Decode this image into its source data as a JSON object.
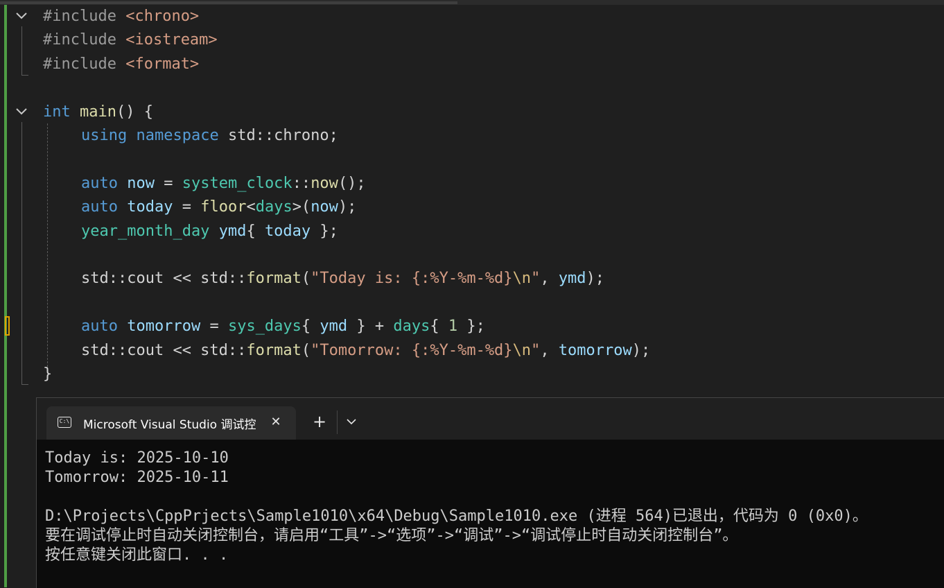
{
  "editor": {
    "lines": [
      {
        "tokens": [
          {
            "c": "pp",
            "t": "#include "
          },
          {
            "c": "inc",
            "t": "<chrono>"
          }
        ]
      },
      {
        "tokens": [
          {
            "c": "pp",
            "t": "#include "
          },
          {
            "c": "inc",
            "t": "<iostream>"
          }
        ]
      },
      {
        "tokens": [
          {
            "c": "pp",
            "t": "#include "
          },
          {
            "c": "inc",
            "t": "<format>"
          }
        ]
      },
      {
        "tokens": []
      },
      {
        "tokens": [
          {
            "c": "kw",
            "t": "int"
          },
          {
            "c": "pl",
            "t": " "
          },
          {
            "c": "fn",
            "t": "main"
          },
          {
            "c": "pl",
            "t": "() {"
          }
        ]
      },
      {
        "indent": true,
        "tokens": [
          {
            "c": "kw",
            "t": "using"
          },
          {
            "c": "pl",
            "t": " "
          },
          {
            "c": "kw",
            "t": "namespace"
          },
          {
            "c": "pl",
            "t": " std::chrono;"
          }
        ]
      },
      {
        "tokens": []
      },
      {
        "indent": true,
        "tokens": [
          {
            "c": "kw",
            "t": "auto"
          },
          {
            "c": "pl",
            "t": " "
          },
          {
            "c": "var",
            "t": "now"
          },
          {
            "c": "pl",
            "t": " = "
          },
          {
            "c": "ty",
            "t": "system_clock"
          },
          {
            "c": "pl",
            "t": "::"
          },
          {
            "c": "fn",
            "t": "now"
          },
          {
            "c": "pl",
            "t": "();"
          }
        ]
      },
      {
        "indent": true,
        "tokens": [
          {
            "c": "kw",
            "t": "auto"
          },
          {
            "c": "pl",
            "t": " "
          },
          {
            "c": "var",
            "t": "today"
          },
          {
            "c": "pl",
            "t": " = "
          },
          {
            "c": "fn",
            "t": "floor"
          },
          {
            "c": "pl",
            "t": "<"
          },
          {
            "c": "ty",
            "t": "days"
          },
          {
            "c": "pl",
            "t": ">("
          },
          {
            "c": "var",
            "t": "now"
          },
          {
            "c": "pl",
            "t": ");"
          }
        ]
      },
      {
        "indent": true,
        "tokens": [
          {
            "c": "ty",
            "t": "year_month_day"
          },
          {
            "c": "pl",
            "t": " "
          },
          {
            "c": "var",
            "t": "ymd"
          },
          {
            "c": "pl",
            "t": "{ "
          },
          {
            "c": "var",
            "t": "today"
          },
          {
            "c": "pl",
            "t": " };"
          }
        ]
      },
      {
        "tokens": []
      },
      {
        "indent": true,
        "tokens": [
          {
            "c": "pl",
            "t": "std::cout << std::"
          },
          {
            "c": "fn",
            "t": "format"
          },
          {
            "c": "pl",
            "t": "("
          },
          {
            "c": "str",
            "t": "\"Today is: {:%Y-%m-%d}"
          },
          {
            "c": "esc",
            "t": "\\n"
          },
          {
            "c": "str",
            "t": "\""
          },
          {
            "c": "pl",
            "t": ", "
          },
          {
            "c": "var",
            "t": "ymd"
          },
          {
            "c": "pl",
            "t": ");"
          }
        ]
      },
      {
        "tokens": []
      },
      {
        "indent": true,
        "tokens": [
          {
            "c": "kw",
            "t": "auto"
          },
          {
            "c": "pl",
            "t": " "
          },
          {
            "c": "var",
            "t": "tomorrow"
          },
          {
            "c": "pl",
            "t": " = "
          },
          {
            "c": "ty",
            "t": "sys_days"
          },
          {
            "c": "pl",
            "t": "{ "
          },
          {
            "c": "var",
            "t": "ymd"
          },
          {
            "c": "pl",
            "t": " } + "
          },
          {
            "c": "ty",
            "t": "days"
          },
          {
            "c": "pl",
            "t": "{ "
          },
          {
            "c": "num",
            "t": "1"
          },
          {
            "c": "pl",
            "t": " };"
          }
        ]
      },
      {
        "indent": true,
        "tokens": [
          {
            "c": "pl",
            "t": "std::cout << std::"
          },
          {
            "c": "fn",
            "t": "format"
          },
          {
            "c": "pl",
            "t": "("
          },
          {
            "c": "str",
            "t": "\"Tomorrow: {:%Y-%m-%d}"
          },
          {
            "c": "esc",
            "t": "\\n"
          },
          {
            "c": "str",
            "t": "\""
          },
          {
            "c": "pl",
            "t": ", "
          },
          {
            "c": "var",
            "t": "tomorrow"
          },
          {
            "c": "pl",
            "t": ");"
          }
        ]
      },
      {
        "tokens": [
          {
            "c": "pl",
            "t": "}"
          }
        ]
      }
    ]
  },
  "terminal": {
    "tab_title": "Microsoft Visual Studio 调试控",
    "tab_icon_text": "C:\\",
    "close_glyph": "✕",
    "new_tab_glyph": "+",
    "output": [
      "Today is: 2025-10-10",
      "Tomorrow: 2025-10-11",
      "",
      "D:\\Projects\\CppPrjects\\Sample1010\\x64\\Debug\\Sample1010.exe (进程 564)已退出，代码为 0 (0x0)。",
      "要在调试停止时自动关闭控制台，请启用“工具”->“选项”->“调试”->“调试停止时自动关闭控制台”。",
      "按任意键关闭此窗口. . ."
    ]
  },
  "colors": {
    "change_bar": "#4f9d45",
    "caret_marker": "#e0a200",
    "keyword": "#569cd6",
    "function": "#dcdcaa",
    "type": "#4ec9b0",
    "variable": "#9cdcfe",
    "string": "#d69d85"
  },
  "icons": [
    "chevron-down-icon",
    "console-icon",
    "close-icon",
    "plus-icon"
  ]
}
